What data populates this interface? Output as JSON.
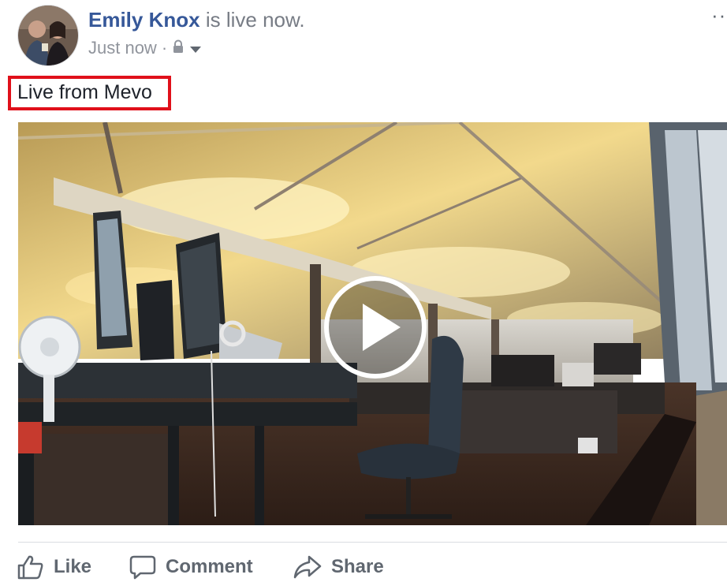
{
  "post": {
    "author_name": "Emily Knox",
    "status_text": "is live now.",
    "timestamp": "Just now",
    "separator": "·",
    "privacy_icon": "lock-icon",
    "audience_icon": "caret-down-icon",
    "more_label": "···",
    "caption": "Live from Mevo",
    "caption_highlight_color": "#e0101a"
  },
  "video": {
    "thumbnail": "office-interior-photo",
    "play_icon": "play-icon"
  },
  "actions": {
    "like_label": "Like",
    "comment_label": "Comment",
    "share_label": "Share"
  },
  "colors": {
    "author": "#365899",
    "secondary_text": "#90949c",
    "action_text": "#606770"
  }
}
